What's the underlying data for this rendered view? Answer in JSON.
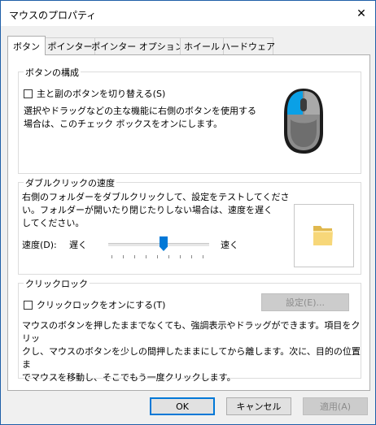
{
  "window": {
    "title": "マウスのプロパティ",
    "close_glyph": "✕"
  },
  "tabs": [
    {
      "label": "ボタン",
      "active": true
    },
    {
      "label": "ポインター",
      "active": false
    },
    {
      "label": "ポインター オプション",
      "active": false
    },
    {
      "label": "ホイール",
      "active": false
    },
    {
      "label": "ハードウェア",
      "active": false
    }
  ],
  "button_config": {
    "title": "ボタンの構成",
    "swap_checkbox_label": "主と副のボタンを切り替える(S)",
    "swap_checked": false,
    "description_line1": "選択やドラッグなどの主な機能に右側のボタンを使用する",
    "description_line2": "場合は、このチェック ボックスをオンにします。",
    "mouse_icon": "mouse-left-button-highlighted-icon"
  },
  "double_click": {
    "title": "ダブルクリックの速度",
    "description_line1": "右側のフォルダーをダブルクリックして、設定をテストしてくださ",
    "description_line2": "い。フォルダーが開いたり閉じたりしない場合は、速度を遅く",
    "description_line3": "してください。",
    "speed_label": "速度(D):",
    "slow_label": "遅く",
    "fast_label": "速く",
    "speed_value": 0.55,
    "folder_icon": "folder-icon"
  },
  "click_lock": {
    "title": "クリックロック",
    "checkbox_label": "クリックロックをオンにする(T)",
    "checked": false,
    "settings_button": "設定(E)...",
    "description_line1": "マウスのボタンを押したままでなくても、強調表示やドラッグができます。項目をクリッ",
    "description_line2": "クし、マウスのボタンを少しの間押したままにしてから離します。次に、目的の位置ま",
    "description_line3": "でマウスを移動し、そこでもう一度クリックします。"
  },
  "footer": {
    "ok": "OK",
    "cancel": "キャンセル",
    "apply": "適用(A)"
  },
  "colors": {
    "accent": "#0078d7"
  }
}
